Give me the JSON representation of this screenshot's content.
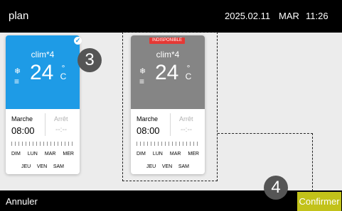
{
  "header": {
    "title": "plan",
    "date": "2025.02.11",
    "weekday": "MAR",
    "time": "11:26"
  },
  "colors": {
    "accent_blue": "#1e9be6",
    "disabled_gray": "#858585",
    "badge_red": "#e53935",
    "confirm_olive": "#c2c21a"
  },
  "cards": [
    {
      "name": "clim*4",
      "temperature": "24",
      "unit_deg": "°",
      "unit_c": "C",
      "selected": true,
      "check_glyph": "✓",
      "on_label": "Marche",
      "on_time": "08:00",
      "off_label": "Arrêt",
      "off_time": "--:--",
      "days_row1": [
        "DIM",
        "LUN",
        "MAR",
        "MER"
      ],
      "days_row2": [
        "JEU",
        "VEN",
        "SAM"
      ]
    },
    {
      "name": "clim*4",
      "badge": "INDISPONIBLE",
      "temperature": "24",
      "unit_deg": "°",
      "unit_c": "C",
      "on_label": "Marche",
      "on_time": "08:00",
      "off_label": "Arrêt",
      "off_time": "--:--",
      "days_row1": [
        "DIM",
        "LUN",
        "MAR",
        "MER"
      ],
      "days_row2": [
        "JEU",
        "VEN",
        "SAM"
      ]
    }
  ],
  "callouts": [
    "3",
    "4"
  ],
  "icons": {
    "mode": "snowflake-icon",
    "fan": "fan-speed-icon"
  },
  "glyphs": {
    "snow": "❄",
    "fan": "≡"
  },
  "footer": {
    "cancel_label": "Annuler",
    "confirm_label": "Confirmer"
  }
}
